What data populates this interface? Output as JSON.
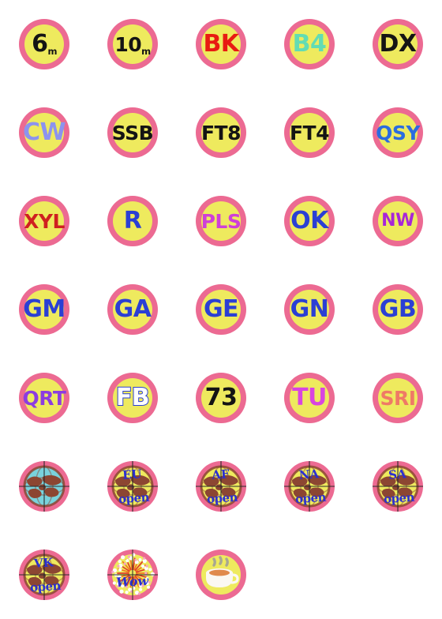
{
  "sheet": {
    "title": "Ham Radio Emoji Sticker Sheet",
    "columns": 5,
    "rows": 7,
    "cell_size": 112,
    "badge_diameter": 64,
    "palette": {
      "background": "#ffffff",
      "ring_pink": "#ec6a92",
      "disc_yellow": "#eeea5e",
      "black": "#141414",
      "red": "#e81b12",
      "mint": "#62dcb4",
      "periwinkle": "#8c93ef",
      "blue": "#2b3fd4",
      "royal_blue": "#2b2fd0",
      "crimson": "#cf2020",
      "magenta": "#cf3fd8",
      "violet": "#a726d8",
      "purple": "#8c3ce0",
      "hot_magenta": "#d845e0",
      "coral": "#ef7a66",
      "white": "#fdfdfd",
      "globe_land": "#8c4632",
      "globe_ocean_blue": "#79d2dc",
      "globe_ocean_yellow": "#eeea5e",
      "crosshair": "#2a2a2a",
      "cup_white": "#fbf8f2",
      "coffee": "#e08a4c",
      "steam": "#9c9c9c",
      "burst_orange": "#f07a1e",
      "burst_red": "#e03c2a",
      "speckle_pink": "#f6a8c0"
    }
  },
  "stickers": [
    {
      "id": "6m",
      "row": 0,
      "col": 0,
      "kind": "text",
      "text": "6",
      "sub": "m",
      "size": "sz-1",
      "color": "#141414"
    },
    {
      "id": "10m",
      "row": 0,
      "col": 1,
      "kind": "text",
      "text": "10",
      "sub": "m",
      "size": "sz-2",
      "color": "#141414"
    },
    {
      "id": "BK",
      "row": 0,
      "col": 2,
      "kind": "text",
      "text": "BK",
      "sub": "",
      "size": "sz-1",
      "color": "#e81b12"
    },
    {
      "id": "B4",
      "row": 0,
      "col": 3,
      "kind": "text",
      "text": "B4",
      "sub": "",
      "size": "sz-1",
      "color": "#62dcb4"
    },
    {
      "id": "DX",
      "row": 0,
      "col": 4,
      "kind": "text",
      "text": "DX",
      "sub": "",
      "size": "sz-1",
      "color": "#141414"
    },
    {
      "id": "CW",
      "row": 1,
      "col": 0,
      "kind": "text",
      "text": "CW",
      "sub": "",
      "size": "sz-1",
      "color": "#8c93ef"
    },
    {
      "id": "SSB",
      "row": 1,
      "col": 1,
      "kind": "text",
      "text": "SSB",
      "sub": "",
      "size": "sz-2",
      "color": "#141414"
    },
    {
      "id": "FT8",
      "row": 1,
      "col": 2,
      "kind": "text",
      "text": "FT8",
      "sub": "",
      "size": "sz-2",
      "color": "#141414"
    },
    {
      "id": "FT4",
      "row": 1,
      "col": 3,
      "kind": "text",
      "text": "FT4",
      "sub": "",
      "size": "sz-2",
      "color": "#141414"
    },
    {
      "id": "QSY",
      "row": 1,
      "col": 4,
      "kind": "text",
      "text": "QSY",
      "sub": "",
      "size": "sz-2",
      "color": "#2b6ce0"
    },
    {
      "id": "XYL",
      "row": 2,
      "col": 0,
      "kind": "text",
      "text": "XYL",
      "sub": "",
      "size": "sz-2",
      "color": "#cf2020"
    },
    {
      "id": "R",
      "row": 2,
      "col": 1,
      "kind": "text",
      "text": "R",
      "sub": "",
      "size": "sz-1",
      "color": "#2b3fd4"
    },
    {
      "id": "PLS",
      "row": 2,
      "col": 2,
      "kind": "text",
      "text": "PLS",
      "sub": "",
      "size": "sz-2",
      "color": "#cf3fd8"
    },
    {
      "id": "OK",
      "row": 2,
      "col": 3,
      "kind": "text",
      "text": "OK",
      "sub": "",
      "size": "sz-1",
      "color": "#2b3fd4"
    },
    {
      "id": "NW",
      "row": 2,
      "col": 4,
      "kind": "text",
      "text": "NW",
      "sub": "",
      "size": "sz-2s",
      "color": "#a726d8"
    },
    {
      "id": "GM",
      "row": 3,
      "col": 0,
      "kind": "text",
      "text": "GM",
      "sub": "",
      "size": "sz-1",
      "color": "#2b3fd4"
    },
    {
      "id": "GA",
      "row": 3,
      "col": 1,
      "kind": "text",
      "text": "GA",
      "sub": "",
      "size": "sz-1",
      "color": "#2b3fd4"
    },
    {
      "id": "GE",
      "row": 3,
      "col": 2,
      "kind": "text",
      "text": "GE",
      "sub": "",
      "size": "sz-1",
      "color": "#2b3fd4"
    },
    {
      "id": "GN",
      "row": 3,
      "col": 3,
      "kind": "text",
      "text": "GN",
      "sub": "",
      "size": "sz-1",
      "color": "#2b3fd4"
    },
    {
      "id": "GB",
      "row": 3,
      "col": 4,
      "kind": "text",
      "text": "GB",
      "sub": "",
      "size": "sz-1",
      "color": "#2b3fd4"
    },
    {
      "id": "QRT",
      "row": 4,
      "col": 0,
      "kind": "text",
      "text": "QRT",
      "sub": "",
      "size": "sz-2",
      "color": "#8c3ce0"
    },
    {
      "id": "FB",
      "row": 4,
      "col": 1,
      "kind": "outlined",
      "text": "FB",
      "sub": "",
      "size": "sz-1",
      "color": "#fdfdfd"
    },
    {
      "id": "73",
      "row": 4,
      "col": 2,
      "kind": "text",
      "text": "73",
      "sub": "",
      "size": "sz-1",
      "color": "#141414"
    },
    {
      "id": "TU",
      "row": 4,
      "col": 3,
      "kind": "text",
      "text": "TU",
      "sub": "",
      "size": "sz-1",
      "color": "#d845e0"
    },
    {
      "id": "SRI",
      "row": 4,
      "col": 4,
      "kind": "text",
      "text": "SRI",
      "sub": "",
      "size": "sz-2",
      "color": "#ef7a66"
    },
    {
      "id": "globe-blue",
      "row": 5,
      "col": 0,
      "kind": "globe",
      "ocean": "#79d2dc",
      "top": "",
      "bottom": ""
    },
    {
      "id": "eu-open",
      "row": 5,
      "col": 1,
      "kind": "globe",
      "ocean": "#eeea5e",
      "top": "EU",
      "bottom": "open"
    },
    {
      "id": "af-open",
      "row": 5,
      "col": 2,
      "kind": "globe",
      "ocean": "#eeea5e",
      "top": "AF",
      "bottom": "open"
    },
    {
      "id": "na-open",
      "row": 5,
      "col": 3,
      "kind": "globe",
      "ocean": "#eeea5e",
      "top": "NA",
      "bottom": "open"
    },
    {
      "id": "sa-open",
      "row": 5,
      "col": 4,
      "kind": "globe",
      "ocean": "#eeea5e",
      "top": "SA",
      "bottom": "open"
    },
    {
      "id": "vk-open",
      "row": 6,
      "col": 0,
      "kind": "globe",
      "ocean": "#eeea5e",
      "top": "VK",
      "bottom": "open"
    },
    {
      "id": "wow",
      "row": 6,
      "col": 1,
      "kind": "burst",
      "text": "Wow"
    },
    {
      "id": "coffee",
      "row": 6,
      "col": 2,
      "kind": "coffee",
      "text": ""
    }
  ]
}
